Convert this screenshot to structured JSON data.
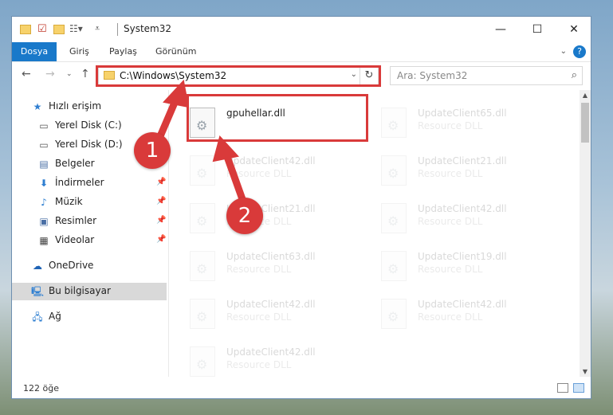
{
  "window": {
    "title": "System32",
    "minimize": "—",
    "maximize": "☐",
    "close": "✕"
  },
  "ribbon": {
    "tabs": [
      "Dosya",
      "Giriş",
      "Paylaş",
      "Görünüm"
    ],
    "help": "?"
  },
  "navigation": {
    "address": "C:\\Windows\\System32",
    "search_placeholder": "Ara: System32"
  },
  "sidebar": {
    "items": [
      {
        "label": "Hızlı erişim",
        "icon": "star-icon"
      },
      {
        "label": "Yerel Disk (C:)",
        "icon": "drive-icon"
      },
      {
        "label": "Yerel Disk (D:)",
        "icon": "drive-icon"
      },
      {
        "label": "Belgeler",
        "icon": "document-icon"
      },
      {
        "label": "İndirmeler",
        "icon": "download-icon"
      },
      {
        "label": "Müzik",
        "icon": "music-icon"
      },
      {
        "label": "Resimler",
        "icon": "pictures-icon"
      },
      {
        "label": "Videolar",
        "icon": "video-icon"
      },
      {
        "label": "OneDrive",
        "icon": "cloud-icon"
      },
      {
        "label": "Bu bilgisayar",
        "icon": "computer-icon",
        "selected": true
      },
      {
        "label": "Ağ",
        "icon": "network-icon"
      }
    ]
  },
  "files": [
    {
      "name": "gpuhellar.dll",
      "desc": "",
      "highlighted": true
    },
    {
      "name": "UpdateClient65.dll",
      "desc": "Resource DLL"
    },
    {
      "name": "UpdateClient42.dll",
      "desc": "Resource DLL"
    },
    {
      "name": "UpdateClient21.dll",
      "desc": "Resource DLL"
    },
    {
      "name": "UpdateClient21.dll",
      "desc": "Resource DLL"
    },
    {
      "name": "UpdateClient42.dll",
      "desc": "Resource DLL"
    },
    {
      "name": "UpdateClient63.dll",
      "desc": "Resource DLL"
    },
    {
      "name": "UpdateClient19.dll",
      "desc": "Resource DLL"
    },
    {
      "name": "UpdateClient42.dll",
      "desc": "Resource DLL"
    },
    {
      "name": "UpdateClient42.dll",
      "desc": "Resource DLL"
    },
    {
      "name": "UpdateClient42.dll",
      "desc": "Resource DLL"
    }
  ],
  "status": {
    "item_count": "122 öğe"
  },
  "annotations": {
    "badge1": "1",
    "badge2": "2",
    "color": "#d93a3a"
  }
}
